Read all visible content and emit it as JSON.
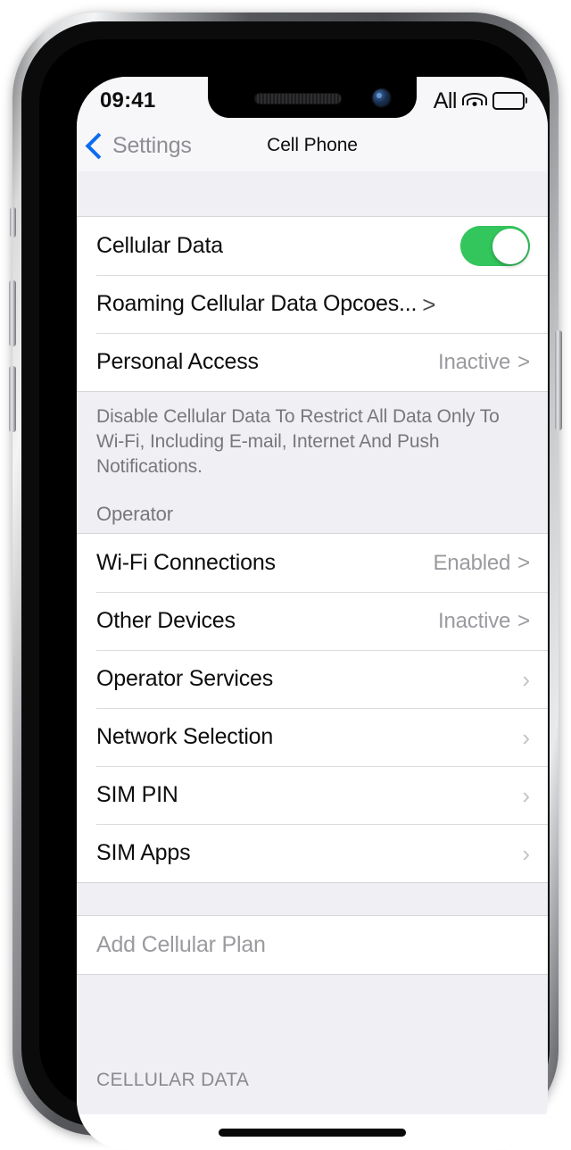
{
  "status_bar": {
    "time": "09:41",
    "carrier": "All",
    "wifi_icon": "wifi-icon",
    "battery_icon": "battery-full-icon"
  },
  "nav_bar": {
    "back_label": "Settings",
    "back_icon": "chevron-left-icon",
    "title": "Cell Phone"
  },
  "colors": {
    "accent_blue": "#0a6cf0",
    "toggle_green": "#33C65C",
    "background": "#F0EFF4",
    "row_background": "#FFFFFF",
    "secondary_text": "#9a9a9f"
  },
  "groups": [
    {
      "id": "cellular-data-group",
      "rows": [
        {
          "name": "cellular-data",
          "label": "Cellular Data",
          "control": "toggle",
          "toggle_on": true
        },
        {
          "name": "roaming-cellular-data-options",
          "label": "Roaming Cellular Data Opcoes...",
          "control": "inline-chevron",
          "chevron": ">"
        },
        {
          "name": "personal-access",
          "label": "Personal Access",
          "value": "Inactive",
          "control": "value-chevron",
          "chevron": ">"
        }
      ],
      "footer": "Disable Cellular Data To Restrict All Data Only To Wi-Fi, Including E-mail, Internet And Push Notifications."
    },
    {
      "id": "operator-group",
      "header": "Operator",
      "rows": [
        {
          "name": "wifi-connections",
          "label": "Wi-Fi Connections",
          "value": "Enabled",
          "control": "value-chevron",
          "chevron": ">"
        },
        {
          "name": "other-devices",
          "label": "Other Devices",
          "value": "Inactive",
          "control": "value-chevron",
          "chevron": ">"
        },
        {
          "name": "operator-services",
          "label": "Operator Services",
          "control": "chevron",
          "chevron": "›"
        },
        {
          "name": "network-selection",
          "label": "Network Selection",
          "control": "chevron",
          "chevron": "›"
        },
        {
          "name": "sim-pin",
          "label": "SIM PIN",
          "control": "chevron",
          "chevron": "›"
        },
        {
          "name": "sim-apps",
          "label": "SIM Apps",
          "control": "chevron",
          "chevron": "›"
        }
      ]
    },
    {
      "id": "add-plan-group",
      "rows": [
        {
          "name": "add-cellular-plan",
          "label": "Add Cellular Plan",
          "control": "none",
          "muted": true
        }
      ]
    }
  ],
  "bottom_section_header": "CELLULAR DATA",
  "home_indicator": "home-indicator"
}
